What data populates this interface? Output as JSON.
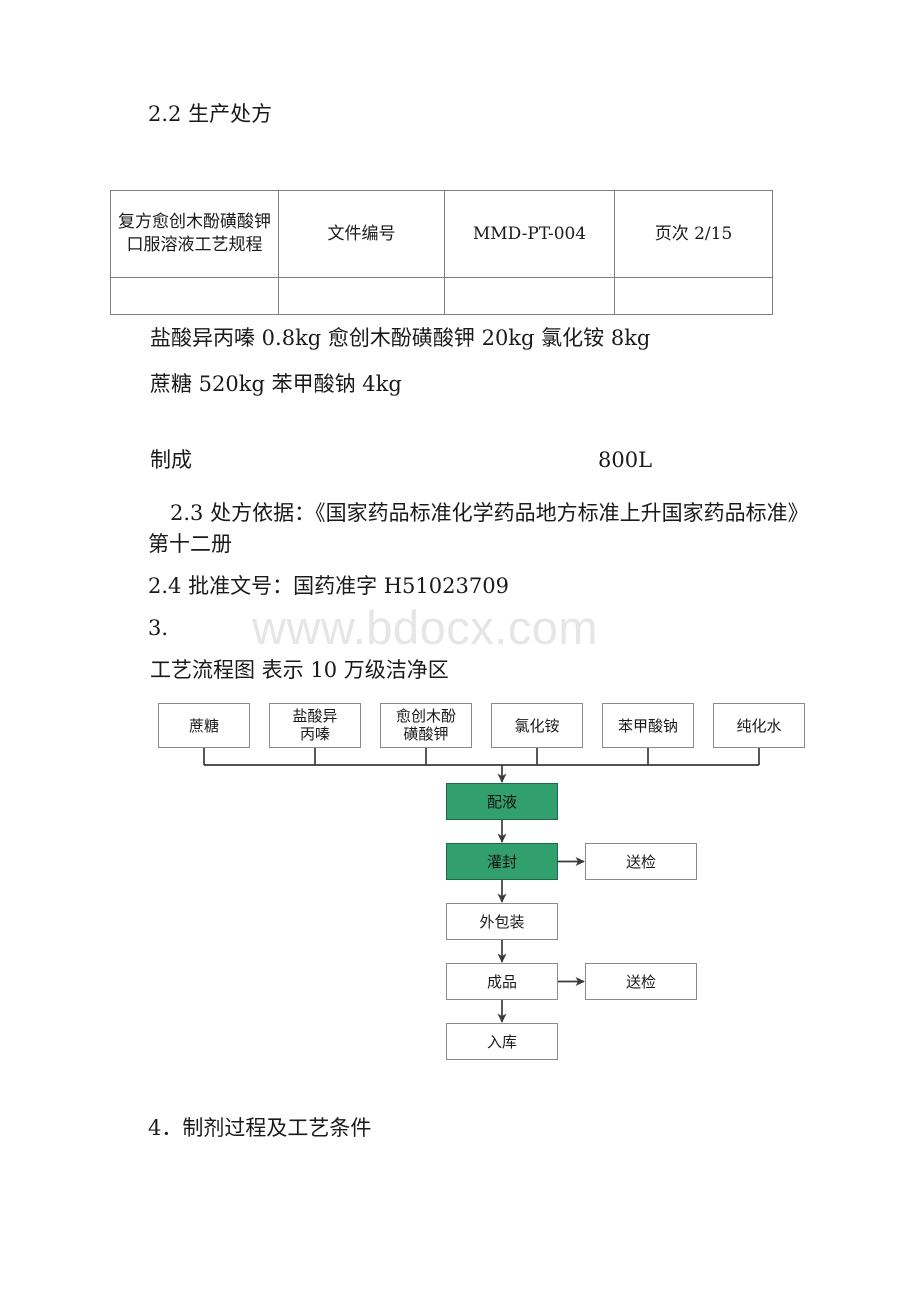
{
  "watermark": "www.bdocx.com",
  "headings": {
    "sec_2_2": "2.2 生产处方",
    "sec_2_3": "2.3 处方依据：《国家药品标准化学药品地方标准上升国家药品标准》第十二册",
    "sec_2_4": "2.4 批准文号：国药准字 H51023709",
    "sec_3_number": "3.",
    "flow_title": "工艺流程图 表示 10 万级洁净区",
    "sec_4": "4．制剂过程及工艺条件"
  },
  "doc_table": {
    "rows": [
      {
        "title": "复方愈创木酚磺酸钾口服溶液工艺规程",
        "code_label": "文件编号",
        "code_value": "MMD-PT-004",
        "page_label": "页次 2/15"
      },
      {
        "title": "",
        "code_label": "",
        "code_value": "",
        "page_label": ""
      }
    ]
  },
  "formula": {
    "line1": "盐酸异丙嗪 0.8kg  愈创木酚磺酸钾 20kg 氯化铵 8kg",
    "line2": "蔗糖 520kg 苯甲酸钠 4kg",
    "yield_label": "制成",
    "yield_value": "800L"
  },
  "flowchart": {
    "materials": [
      "蔗糖",
      "盐酸异\n丙嗪",
      "愈创木酚\n磺酸钾",
      "氯化铵",
      "苯甲酸钠",
      "纯化水"
    ],
    "process": [
      {
        "label": "配液",
        "clean_room": true
      },
      {
        "label": "灌封",
        "clean_room": true
      },
      {
        "label": "外包装",
        "clean_room": false
      },
      {
        "label": "成品",
        "clean_room": false
      },
      {
        "label": "入库",
        "clean_room": false
      }
    ],
    "inspections": [
      {
        "label": "送检",
        "from": "灌封"
      },
      {
        "label": "送检",
        "from": "成品"
      }
    ],
    "colors": {
      "clean_room_fill": "#31a06c",
      "clean_room_border": "#1d6b46",
      "node_border": "#8a8a8a",
      "connector": "#3a3a3a"
    }
  }
}
